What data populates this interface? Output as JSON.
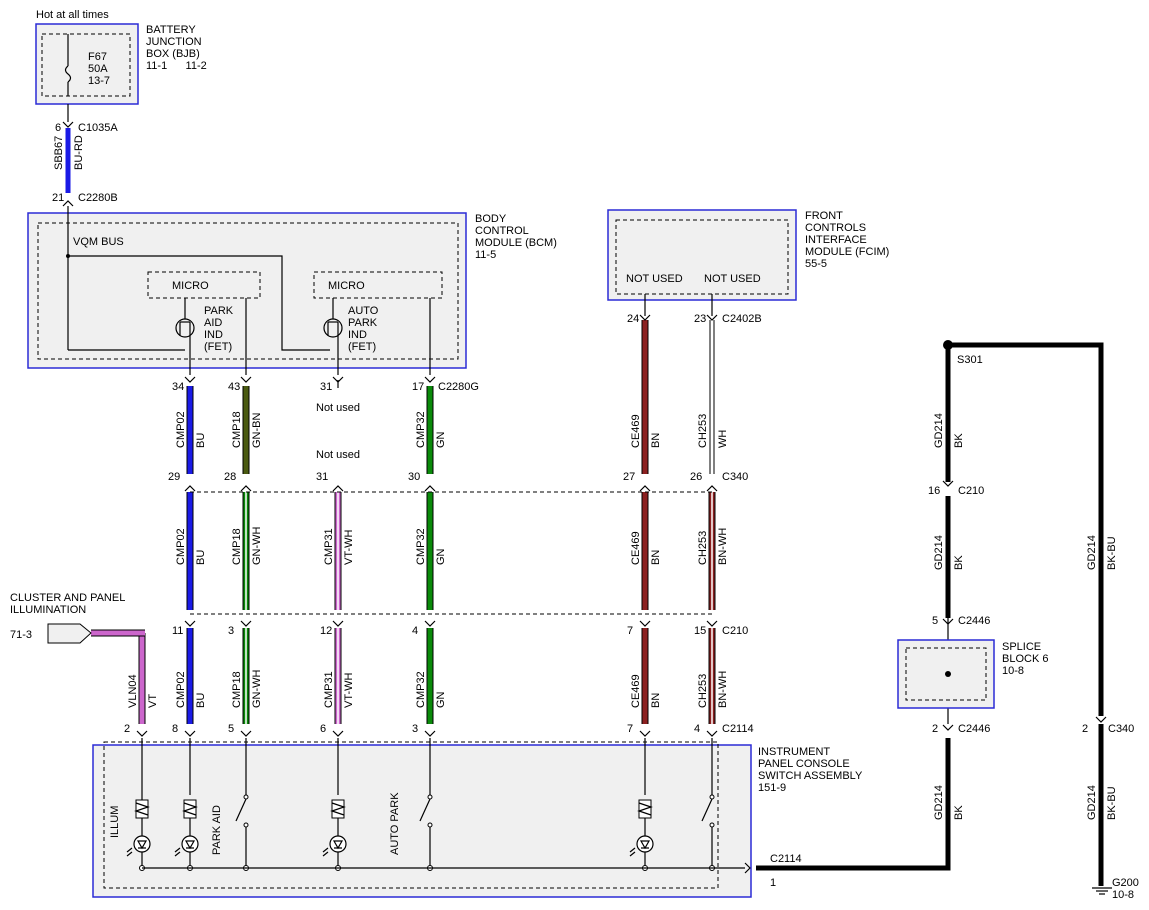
{
  "colors": {
    "BU": "#1a1ae6",
    "GN": "#0a8a0a",
    "GN-BN": "#4a5a10",
    "GN-WH": "#0a8a0a",
    "VT-WH": "#cc66cc",
    "BN": "#8b2020",
    "BN-WH": "#8b2020",
    "WH": "#ffffff",
    "BK": "#000000",
    "BK-BU": "#000000",
    "BU-RD": "#1a1ae6",
    "VT": "#cc66cc"
  },
  "power": {
    "label": "Hot at all times",
    "bjb": {
      "title": [
        "BATTERY",
        "JUNCTION",
        "BOX (BJB)",
        "11-1      11-2"
      ],
      "fuse": [
        "F67",
        "50A",
        "13-7"
      ]
    },
    "wire": {
      "circuit": "SBB67",
      "color": "BU-RD",
      "pin_top": "6",
      "conn_top": "C1035A",
      "pin_bottom": "21",
      "conn_bottom": "C2280B"
    }
  },
  "bcm": {
    "title": [
      "BODY",
      "CONTROL",
      "MODULE (BCM)",
      "11-5"
    ],
    "bus": "VQM BUS",
    "micro": "MICRO",
    "fet1": [
      "PARK",
      "AID",
      "IND",
      "(FET)"
    ],
    "fet2": [
      "AUTO",
      "PARK",
      "IND",
      "(FET)"
    ],
    "connector": "C2280G"
  },
  "fcim": {
    "title": [
      "FRONT",
      "CONTROLS",
      "INTERFACE",
      "MODULE (FCIM)",
      "55-5"
    ],
    "not_used": "NOT USED",
    "connector": "C2402B"
  },
  "not_used": "Not used",
  "top_wires": [
    {
      "pin": "34",
      "circuit": "CMP02",
      "color": "BU"
    },
    {
      "pin": "43",
      "circuit": "CMP18",
      "color": "GN-BN"
    },
    {
      "pin": "31",
      "circuit": "",
      "color": ""
    },
    {
      "pin": "17",
      "circuit": "CMP32",
      "color": "GN"
    },
    {
      "pin": "24",
      "circuit": "CE469",
      "color": "BN"
    },
    {
      "pin": "23",
      "circuit": "CH253",
      "color": "WH"
    }
  ],
  "c340": {
    "connector": "C340",
    "pins": [
      "29",
      "28",
      "31",
      "30",
      "27",
      "26"
    ],
    "wires": [
      {
        "circuit": "CMP02",
        "color": "BU"
      },
      {
        "circuit": "CMP18",
        "color": "GN-WH"
      },
      {
        "circuit": "CMP31",
        "color": "VT-WH"
      },
      {
        "circuit": "CMP32",
        "color": "GN"
      },
      {
        "circuit": "CE469",
        "color": "BN"
      },
      {
        "circuit": "CH253",
        "color": "BN-WH"
      }
    ]
  },
  "c210": {
    "connector": "C210",
    "pins": [
      "11",
      "3",
      "12",
      "4",
      "7",
      "15"
    ]
  },
  "c2114": {
    "connector": "C2114",
    "pins": [
      "2",
      "8",
      "5",
      "6",
      "3",
      "7",
      "4"
    ],
    "wires": [
      {
        "circuit": "VLN04",
        "color": "VT"
      },
      {
        "circuit": "CMP02",
        "color": "BU"
      },
      {
        "circuit": "CMP18",
        "color": "GN-WH"
      },
      {
        "circuit": "CMP31",
        "color": "VT-WH"
      },
      {
        "circuit": "CMP32",
        "color": "GN"
      },
      {
        "circuit": "CE469",
        "color": "BN"
      },
      {
        "circuit": "CH253",
        "color": "BN-WH"
      }
    ],
    "ground_conn": "C2114",
    "ground_pin": "1"
  },
  "cluster": {
    "label": [
      "CLUSTER AND PANEL",
      "ILLUMINATION"
    ],
    "ref": "71-3"
  },
  "ipcs": {
    "title": [
      "INSTRUMENT",
      "PANEL CONSOLE",
      "SWITCH ASSEMBLY",
      "151-9"
    ],
    "illum": "ILLUM",
    "park_aid": "PARK AID",
    "auto_park": "AUTO PARK"
  },
  "ground": {
    "splice": "S301",
    "c210_pin": "16",
    "c210": "C210",
    "c2446_pin_top": "5",
    "c2446": "C2446",
    "c2446_pin_bottom": "2",
    "splice_block": [
      "SPLICE",
      "BLOCK 6",
      "10-8"
    ],
    "c340_pin": "2",
    "c340": "C340",
    "gd": "GD214",
    "bk": "BK",
    "bkbu": "BK-BU",
    "g200": [
      "G200",
      "10-8"
    ]
  }
}
